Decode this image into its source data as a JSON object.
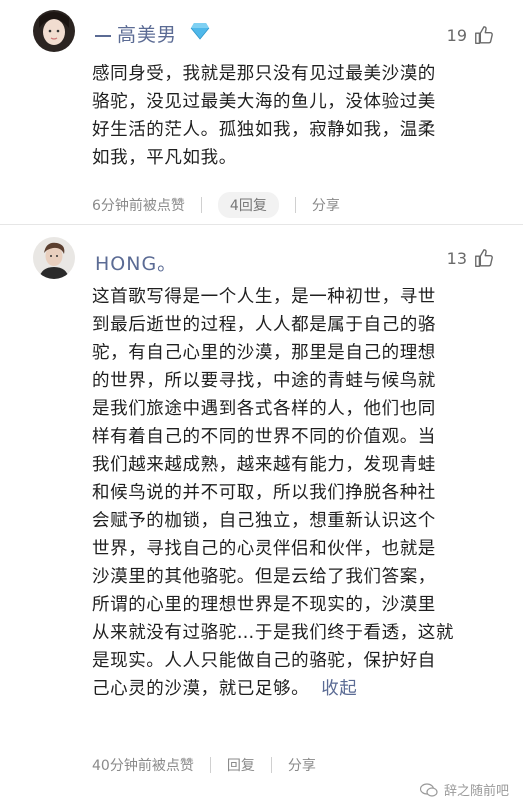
{
  "comments": [
    {
      "username": "高美男",
      "likes": "19",
      "lines": [
        "感同身受，我就是那只没有见过最美沙漠的",
        "骆驼，没见过最美大海的鱼儿，没体验过美",
        "好生活的茫人。孤独如我，寂静如我，温柔",
        "如我，平凡如我。"
      ],
      "time": "6分钟前被点赞",
      "reply": "4回复",
      "share": "分享"
    },
    {
      "username": "HONG。",
      "likes": "13",
      "lines": [
        "这首歌写得是一个人生，是一种初世，寻世",
        "到最后逝世的过程，人人都是属于自己的骆",
        "驼，有自己心里的沙漠，那里是自己的理想",
        "的世界，所以要寻找，中途的青蛙与候鸟就",
        "是我们旅途中遇到各式各样的人，他们也同",
        "样有着自己的不同的世界不同的价值观。当",
        "我们越来越成熟，越来越有能力，发现青蛙",
        "和候鸟说的并不可取，所以我们挣脱各种社",
        "会赋予的枷锁，自己独立，想重新认识这个",
        "世界，寻找自己的心灵伴侣和伙伴，也就是",
        "沙漠里的其他骆驼。但是云给了我们答案，",
        "所谓的心里的理想世界是不现实的，沙漠里",
        "从来就没有过骆驼…于是我们终于看透，这就",
        "是现实。人人只能做自己的骆驼，保护好自",
        "己心灵的沙漠，就已足够。"
      ],
      "collapse": "收起",
      "time": "40分钟前被点赞",
      "reply": "回复",
      "share": "分享"
    }
  ],
  "watermark": "辞之随前吧",
  "colors": {
    "accent": "#5b6b94",
    "meta": "#8a8a8a",
    "text": "#1f1f1f"
  }
}
